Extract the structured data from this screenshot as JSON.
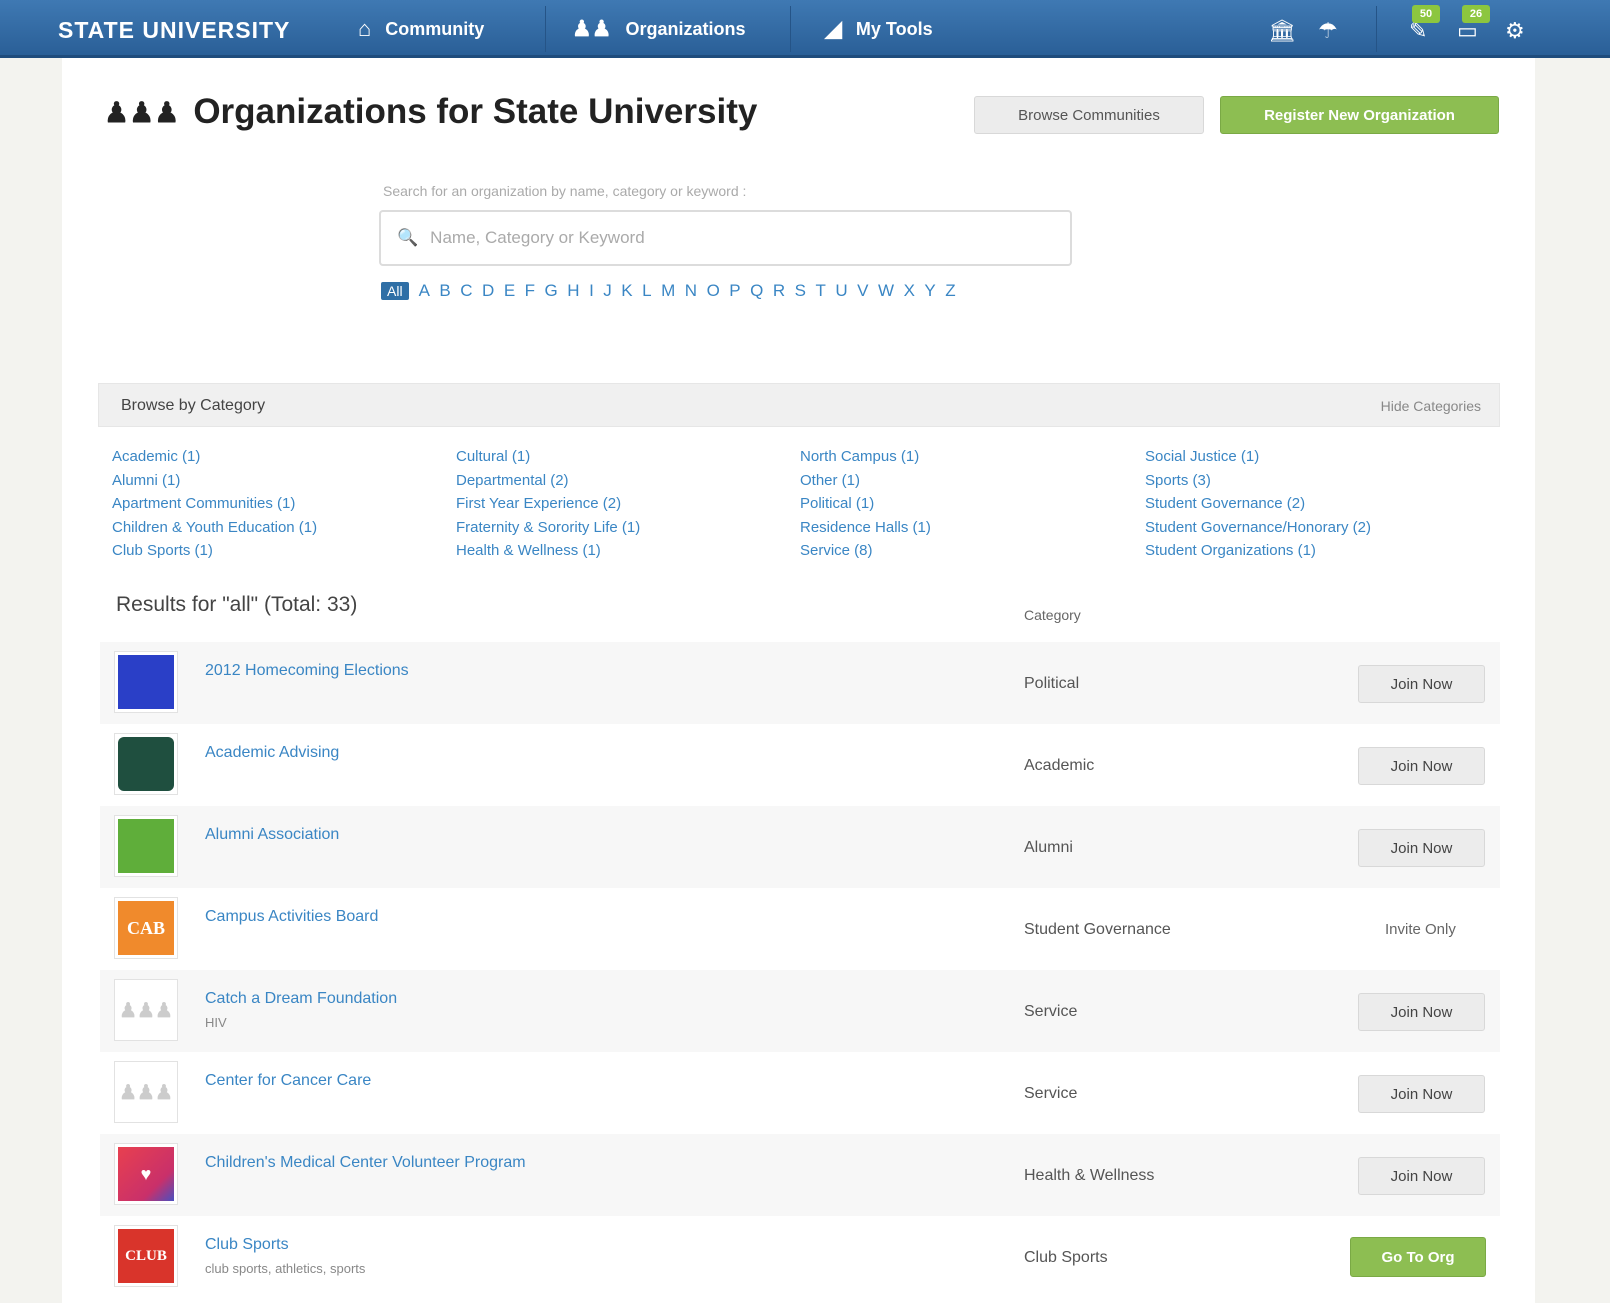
{
  "nav": {
    "brand": "STATE UNIVERSITY",
    "items": [
      {
        "label": "Community",
        "icon": "home-icon"
      },
      {
        "label": "Organizations",
        "icon": "people-icon"
      },
      {
        "label": "My Tools",
        "icon": "tools-icon"
      }
    ],
    "right_icons": [
      "institution-icon",
      "umbrella-icon",
      "pin-icon",
      "inbox-icon",
      "settings-icon"
    ],
    "badges": {
      "pin": "50",
      "inbox": "26"
    }
  },
  "header": {
    "title": "Organizations for State University",
    "browse_button": "Browse Communities",
    "register_button": "Register New Organization"
  },
  "search": {
    "label": "Search for an organization by name, category or keyword :",
    "placeholder": "Name, Category or Keyword",
    "letters": [
      "All",
      "A",
      "B",
      "C",
      "D",
      "E",
      "F",
      "G",
      "H",
      "I",
      "J",
      "K",
      "L",
      "M",
      "N",
      "O",
      "P",
      "Q",
      "R",
      "S",
      "T",
      "U",
      "V",
      "W",
      "X",
      "Y",
      "Z"
    ]
  },
  "categories": {
    "title": "Browse by Category",
    "hide_label": "Hide Categories",
    "columns": [
      [
        "Academic (1)",
        "Alumni (1)",
        "Apartment Communities (1)",
        "Children & Youth Education (1)",
        "Club Sports (1)"
      ],
      [
        "Cultural (1)",
        "Departmental (2)",
        "First Year Experience (2)",
        "Fraternity & Sorority Life (1)",
        "Health & Wellness (1)"
      ],
      [
        "North Campus (1)",
        "Other (1)",
        "Political (1)",
        "Residence Halls (1)",
        "Service (8)"
      ],
      [
        "Social Justice (1)",
        "Sports (3)",
        "Student Governance (2)",
        "Student Governance/Honorary (2)",
        "Student Organizations (1)"
      ]
    ]
  },
  "results": {
    "title": "Results for \"all\" (Total: 33)",
    "category_header": "Category",
    "rows": [
      {
        "name": "2012 Homecoming Elections",
        "sub": "",
        "category": "Political",
        "action": "Join Now",
        "logo_color": "#2a3fc7",
        "logo_text": ""
      },
      {
        "name": "Academic Advising",
        "sub": "",
        "category": "Academic",
        "action": "Join Now",
        "logo_color": "#1f4f3f",
        "logo_text": ""
      },
      {
        "name": "Alumni Association",
        "sub": "",
        "category": "Alumni",
        "action": "Join Now",
        "logo_color": "#5fae3a",
        "logo_text": ""
      },
      {
        "name": "Campus Activities Board",
        "sub": "",
        "category": "Student Governance",
        "action": "Invite Only",
        "logo_color": "#f08a2c",
        "logo_text": "CAB"
      },
      {
        "name": "Catch a Dream Foundation",
        "sub": "HIV",
        "category": "Service",
        "action": "Join Now",
        "logo_color": "#ffffff",
        "logo_text": ""
      },
      {
        "name": "Center for Cancer Care",
        "sub": "",
        "category": "Service",
        "action": "Join Now",
        "logo_color": "#ffffff",
        "logo_text": ""
      },
      {
        "name": "Children's Medical Center Volunteer Program",
        "sub": "",
        "category": "Health & Wellness",
        "action": "Join Now",
        "logo_color": "#e8404f",
        "logo_text": ""
      },
      {
        "name": "Club Sports",
        "sub": "club sports, athletics, sports",
        "category": "Club Sports",
        "action": "Go To Org",
        "logo_color": "#d9342b",
        "logo_text": "CLUB"
      }
    ]
  }
}
